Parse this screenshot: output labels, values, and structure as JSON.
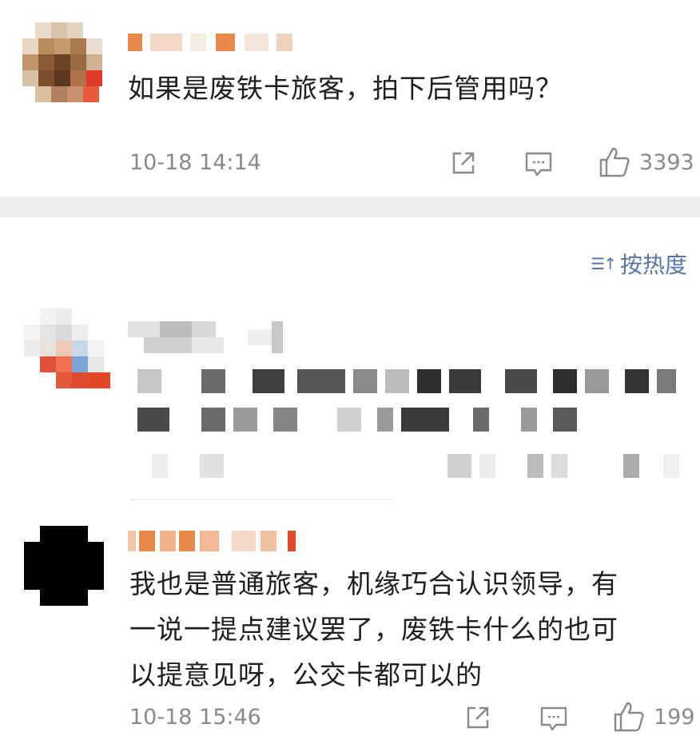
{
  "comments": [
    {
      "name": "",
      "text": "如果是废铁卡旅客，拍下后管用吗？",
      "time": "10-18 14:14",
      "likes": "3393"
    },
    {
      "name": "",
      "text": "",
      "time": "",
      "likes": ""
    },
    {
      "name": "",
      "text": "我也是普通旅客，机缘巧合认识领导，有\n一说一提点建议罢了，废铁卡什么的也可\n以提意见呀，公交卡都可以的",
      "time": "10-18 15:46",
      "likes": "199"
    }
  ],
  "sort": {
    "label": "按热度",
    "icon": "sort-icon"
  },
  "icons": {
    "share": "share-icon",
    "reply": "comment-icon",
    "like": "thumbs-up-icon"
  },
  "colors": {
    "accent": "#5676a8",
    "muted": "#8a8a8a",
    "divider": "#eeeeee"
  }
}
